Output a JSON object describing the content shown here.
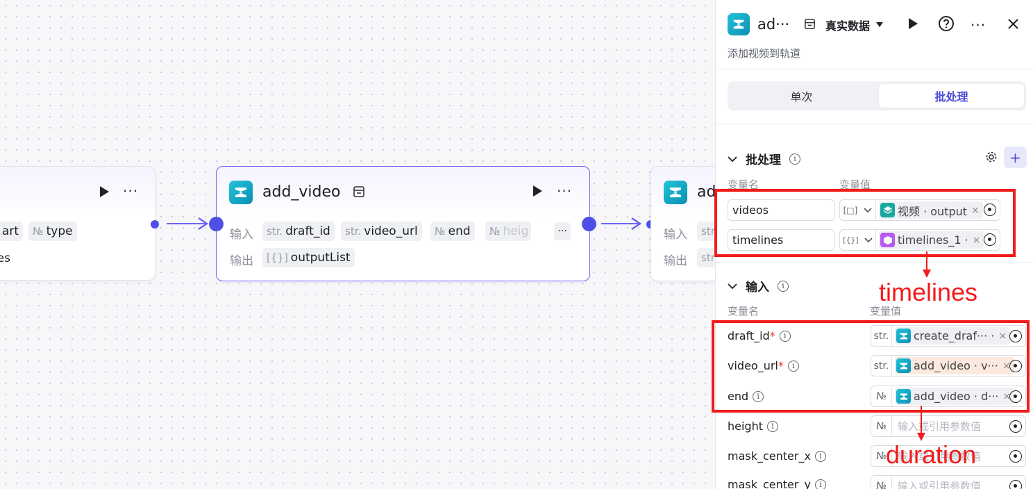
{
  "canvas": {
    "left_node": {
      "tags": [
        "art",
        "type",
        "es"
      ],
      "type_prefix": "№"
    },
    "main_node": {
      "title": "add_video",
      "input_label": "输入",
      "output_label": "输出",
      "inputs": [
        {
          "type": "str.",
          "name": "draft_id"
        },
        {
          "type": "str.",
          "name": "video_url"
        },
        {
          "type": "№",
          "name": "end"
        },
        {
          "type": "№",
          "name": "heig"
        }
      ],
      "more_inputs": "···",
      "outputs": [
        {
          "type": "[{}]",
          "name": "outputList"
        }
      ]
    },
    "right_node": {
      "title": "ad",
      "input_label": "输入",
      "output_label": "输出",
      "tag_type": "str",
      "tag_type2": "str"
    }
  },
  "panel": {
    "title": "ad···",
    "dataset_label": "真实数据",
    "subtitle": "添加视频到轨道",
    "tabs": [
      {
        "label": "单次",
        "active": false
      },
      {
        "label": "批处理",
        "active": true
      }
    ],
    "batch": {
      "heading": "批处理",
      "col_name": "变量名",
      "col_value": "变量值",
      "rows": [
        {
          "name": "videos",
          "type_icon": "[□]",
          "ref_icon": "layers-icon",
          "ref_text": "视频 · output",
          "close": "×"
        },
        {
          "name": "timelines",
          "type_icon": "[{}]",
          "ref_icon": "cube-icon",
          "ref_text": "timelines_1 · ",
          "close": "×"
        }
      ]
    },
    "inputs": {
      "heading": "输入",
      "col_name": "变量名",
      "col_value": "变量值",
      "rows": [
        {
          "name": "draft_id",
          "required": "*",
          "type": "str.",
          "ref_text": "create_draf··· ·",
          "close": "×",
          "placeholder": ""
        },
        {
          "name": "video_url",
          "required": "*",
          "type": "str.",
          "ref_text": "add_video · v···",
          "close": "×",
          "placeholder": ""
        },
        {
          "name": "end",
          "required": "",
          "type": "№",
          "ref_text": "add_video · d···",
          "close": "×",
          "placeholder": ""
        },
        {
          "name": "height",
          "required": "",
          "type": "№",
          "ref_text": "",
          "close": "",
          "placeholder": "输入或引用参数值"
        },
        {
          "name": "mask_center_x",
          "required": "",
          "type": "№",
          "ref_text": "",
          "close": "",
          "placeholder": "输入或引用参数值"
        },
        {
          "name": "mask_center_y",
          "required": "",
          "type": "№",
          "ref_text": "",
          "close": "",
          "placeholder": "输入或引用参数值"
        }
      ]
    }
  },
  "annotations": {
    "label_timelines": "timelines",
    "label_duration": "duration",
    "color": "#f21b1b"
  },
  "colors": {
    "accent": "#4b47d8",
    "port": "#4f4fe8",
    "logo": "#0c8fb3"
  }
}
